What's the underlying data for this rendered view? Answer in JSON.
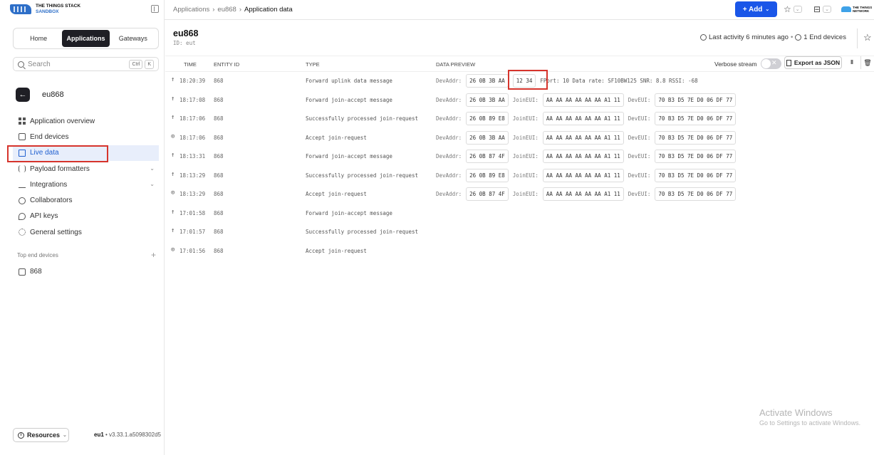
{
  "brand": {
    "line1": "THE THINGS STACK",
    "line2": "SANDBOX"
  },
  "tabs": [
    "Home",
    "Applications",
    "Gateways"
  ],
  "search": {
    "placeholder": "Search",
    "kbd1": "Ctrl",
    "kbd2": "K"
  },
  "app": {
    "name": "eu868",
    "title": "eu868",
    "id": "ID: eut"
  },
  "nav": [
    {
      "label": "Application overview"
    },
    {
      "label": "End devices"
    },
    {
      "label": "Live data"
    },
    {
      "label": "Payload formatters"
    },
    {
      "label": "Integrations"
    },
    {
      "label": "Collaborators"
    },
    {
      "label": "API keys"
    },
    {
      "label": "General settings"
    }
  ],
  "top_end_devices": {
    "label": "Top end devices",
    "device": "868"
  },
  "resources": "Resources",
  "version": {
    "cluster": "eu1",
    "ver": "v3.33.1.a5098302d5"
  },
  "breadcrumbs": [
    "Applications",
    "eu868",
    "Application data"
  ],
  "add_label": "+ Add",
  "ttn_logo": {
    "line1": "THE THINGS",
    "line2": "NETWORK"
  },
  "activity": {
    "last": "Last activity 6 minutes ago",
    "devices": "1 End devices"
  },
  "columns": {
    "time": "TIME",
    "entity": "ENTITY ID",
    "type": "TYPE",
    "preview": "DATA PREVIEW"
  },
  "verbose": "Verbose stream",
  "export": "Export as JSON",
  "rows": [
    {
      "dir": "↑",
      "time": "18:20:39",
      "entity": "868",
      "type": "Forward uplink data message",
      "p": {
        "l1": "DevAddr:",
        "v1": "26 0B 3B AA",
        "v2": "12 34",
        "rest": "FPort: 10  Data rate: SF10BW125  SNR: 8.8  RSSI: -68"
      }
    },
    {
      "dir": "↑",
      "time": "18:17:08",
      "entity": "868",
      "type": "Forward join-accept message",
      "p": {
        "l1": "DevAddr:",
        "v1": "26 0B 3B AA",
        "l2": "JoinEUI:",
        "v2": "AA AA AA AA AA AA A1 11",
        "l3": "DevEUI:",
        "v3": "70 B3 D5 7E D0 06 DF 77"
      }
    },
    {
      "dir": "↑",
      "time": "18:17:06",
      "entity": "868",
      "type": "Successfully processed join-request",
      "p": {
        "l1": "DevAddr:",
        "v1": "26 0B 89 E8",
        "l2": "JoinEUI:",
        "v2": "AA AA AA AA AA AA A1 11",
        "l3": "DevEUI:",
        "v3": "70 B3 D5 7E D0 06 DF 77"
      }
    },
    {
      "dir": "⊙",
      "time": "18:17:06",
      "entity": "868",
      "type": "Accept join-request",
      "p": {
        "l1": "DevAddr:",
        "v1": "26 0B 3B AA",
        "l2": "JoinEUI:",
        "v2": "AA AA AA AA AA AA A1 11",
        "l3": "DevEUI:",
        "v3": "70 B3 D5 7E D0 06 DF 77"
      }
    },
    {
      "dir": "↑",
      "time": "18:13:31",
      "entity": "868",
      "type": "Forward join-accept message",
      "p": {
        "l1": "DevAddr:",
        "v1": "26 0B 87 4F",
        "l2": "JoinEUI:",
        "v2": "AA AA AA AA AA AA A1 11",
        "l3": "DevEUI:",
        "v3": "70 B3 D5 7E D0 06 DF 77"
      }
    },
    {
      "dir": "↑",
      "time": "18:13:29",
      "entity": "868",
      "type": "Successfully processed join-request",
      "p": {
        "l1": "DevAddr:",
        "v1": "26 0B 89 E8",
        "l2": "JoinEUI:",
        "v2": "AA AA AA AA AA AA A1 11",
        "l3": "DevEUI:",
        "v3": "70 B3 D5 7E D0 06 DF 77"
      }
    },
    {
      "dir": "⊙",
      "time": "18:13:29",
      "entity": "868",
      "type": "Accept join-request",
      "p": {
        "l1": "DevAddr:",
        "v1": "26 0B 87 4F",
        "l2": "JoinEUI:",
        "v2": "AA AA AA AA AA AA A1 11",
        "l3": "DevEUI:",
        "v3": "70 B3 D5 7E D0 06 DF 77"
      }
    },
    {
      "dir": "↑",
      "time": "17:01:58",
      "entity": "868",
      "type": "Forward join-accept message",
      "p": null
    },
    {
      "dir": "↑",
      "time": "17:01:57",
      "entity": "868",
      "type": "Successfully processed join-request",
      "p": null
    },
    {
      "dir": "⊙",
      "time": "17:01:56",
      "entity": "868",
      "type": "Accept join-request",
      "p": null
    }
  ],
  "watermark": {
    "title": "Activate Windows",
    "sub": "Go to Settings to activate Windows."
  }
}
